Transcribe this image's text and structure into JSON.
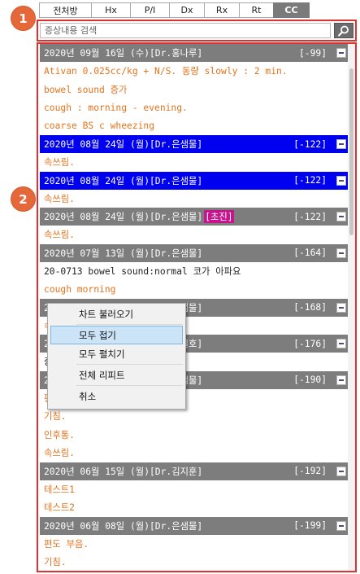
{
  "tabs": [
    {
      "label": "전처방",
      "active": false
    },
    {
      "label": "Hx",
      "active": false
    },
    {
      "label": "P/I",
      "active": false
    },
    {
      "label": "Dx",
      "active": false
    },
    {
      "label": "Rx",
      "active": false
    },
    {
      "label": "Rt",
      "active": false
    },
    {
      "label": "CC",
      "active": true
    }
  ],
  "badges": {
    "one": "1",
    "two": "2"
  },
  "search": {
    "placeholder": "증상내용 검색",
    "value": ""
  },
  "icons": {
    "search": "search-icon",
    "collapse": "minus-box-icon"
  },
  "colors": {
    "accent": "#e5683a",
    "highlight_border": "#e0312f",
    "header_bg": "#7d7d7d",
    "selected_bg": "#0000f0",
    "entry_text": "#e5741e",
    "tag_bg": "#c8148c"
  },
  "entries": [
    {
      "header": "2020년 09월 16일 (수)[Dr.홍나루]",
      "tag": "",
      "number": "[-99]",
      "selected": false,
      "lines": [
        {
          "text": "Ativan 0.025cc/kg + N/S. 동량 slowly : 2 min.",
          "dark": false
        },
        {
          "text": "bowel sound 증가",
          "dark": false
        },
        {
          "text": "cough : morning - evening.",
          "dark": false
        },
        {
          "text": "coarse BS c wheezing",
          "dark": false
        }
      ]
    },
    {
      "header": "2020년 08월 24일 (월)[Dr.은샘물]",
      "tag": "",
      "number": "[-122]",
      "selected": true,
      "lines": [
        {
          "text": "속쓰림.",
          "dark": false
        }
      ]
    },
    {
      "header": "2020년 08월 24일 (월)[Dr.은샘물]",
      "tag": "",
      "number": "[-122]",
      "selected": true,
      "lines": [
        {
          "text": "속쓰림.",
          "dark": false
        }
      ]
    },
    {
      "header": "2020년 08월 24일 (월)[Dr.은샘물]",
      "tag": "[초진]",
      "number": "[-122]",
      "selected": false,
      "lines": [
        {
          "text": "속쓰림.",
          "dark": false
        }
      ]
    },
    {
      "header": "2020년 07월 13일 (월)[Dr.은샘물]",
      "tag": "",
      "number": "[-164]",
      "selected": false,
      "lines": [
        {
          "text": "20-0713 bowel sound:normal 코가 아파요",
          "dark": true
        },
        {
          "text": "cough morning",
          "dark": false
        }
      ]
    },
    {
      "header": "2020년 07월 09일 (목)[Dr.은샘물]",
      "tag": "",
      "number": "[-168]",
      "selected": false,
      "lines": [
        {
          "text": "속쓰림.",
          "dark": false
        }
      ]
    },
    {
      "header": "2020년 07월 02일 (목)[Dr.홍길호]",
      "tag": "",
      "number": "[-176]",
      "selected": false,
      "lines": [
        {
          "text": "증상 입력 테스트 처방 테스트",
          "dark": true
        }
      ]
    },
    {
      "header": "2020년 06월 22일 (월)[Dr.은샘물]",
      "tag": "",
      "number": "[-190]",
      "selected": false,
      "lines": [
        {
          "text": "편도 부음.",
          "dark": false
        },
        {
          "text": "기침.",
          "dark": false
        },
        {
          "text": "인후통.",
          "dark": false
        },
        {
          "text": "속쓰림.",
          "dark": false
        }
      ]
    },
    {
      "header": "2020년 06월 15일 (월)[Dr.김지훈]",
      "tag": "",
      "number": "[-192]",
      "selected": false,
      "lines": [
        {
          "text": "테스트1",
          "dark": false
        },
        {
          "text": "테스트2",
          "dark": false
        }
      ]
    },
    {
      "header": "2020년 06월 08일 (월)[Dr.은샘물]",
      "tag": "",
      "number": "[-199]",
      "selected": false,
      "lines": [
        {
          "text": "편도 부음.",
          "dark": false
        },
        {
          "text": "기침.",
          "dark": false
        },
        {
          "text": "인후통.",
          "dark": false
        }
      ]
    }
  ],
  "context_menu": {
    "items": [
      {
        "label": "차트 불러오기",
        "hover": false,
        "name": "menu-load-chart"
      },
      {
        "label": "모두 접기",
        "hover": true,
        "name": "menu-collapse-all"
      },
      {
        "label": "모두 펼치기",
        "hover": false,
        "name": "menu-expand-all"
      },
      {
        "label": "전체 리피트",
        "hover": false,
        "name": "menu-repeat-all"
      },
      {
        "label": "취소",
        "hover": false,
        "name": "menu-cancel"
      }
    ]
  }
}
